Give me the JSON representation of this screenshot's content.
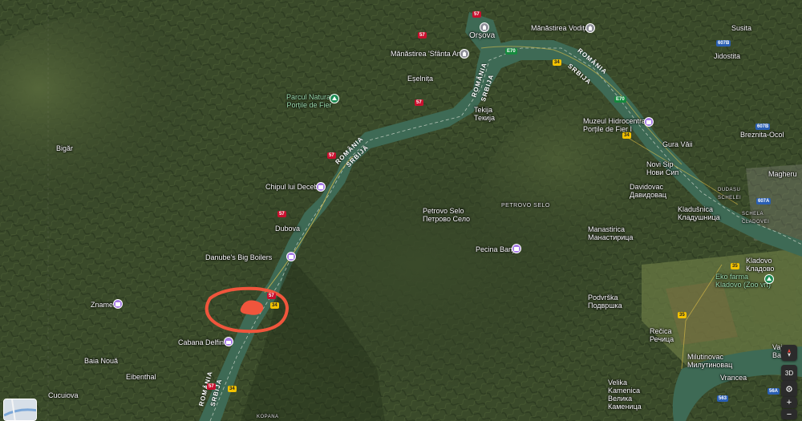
{
  "map": {
    "view": "satellite",
    "river": "Danube",
    "colors": {
      "water": "#3e6a55",
      "terrain_dark": "#2e3b24",
      "terrain_mid": "#4a5a33",
      "annotation": "#f0553c",
      "poi_purple": "#a67ae6",
      "poi_green": "#1f8c55",
      "road_yellow": "#f2c200"
    },
    "annotation": {
      "type": "hand-drawn circle with filled blob",
      "color": "#f0553c"
    }
  },
  "places": {
    "orsova": "Orșova",
    "manastirea_vodita": "Mănăstirea Vodița",
    "susita": "Susita",
    "manastirea_sfanta_ana": "Mănăstirea 'Sfânta Ana'",
    "jidostita": "Jidostita",
    "eselnita": "Eșelnița",
    "parcul_natural": "Parcul Natural\nPorțile de Fier",
    "tekija": "Tekija",
    "tekija_cyr": "Текија",
    "muzeul_hidro": "Muzeul Hidrocentralei\nPorțile de Fier I",
    "bigar": "Bigăr",
    "breznita": "Breznita-Ocol",
    "gura_vaii": "Gura Văii",
    "novi_sip": "Novi Sip",
    "novi_sip_cyr": "Нови Сип",
    "magheru": "Magheru",
    "chipul_decebal": "Chipul lui Decebal",
    "davidovac": "Davidovac",
    "davidovac_cyr": "Давидовац",
    "dudasu": "DUDAȘU\nSCHELEI",
    "schela": "SCHELA\nCLADOVEI",
    "petrovo_selo": "Petrovo Selo",
    "petrovo_selo_cyr": "Петрово Село",
    "petrovo_selo_road": "PETROVO SELO",
    "kladusnica": "Kladušnica",
    "kladusnica_cyr": "Кладушница",
    "dubova": "Dubova",
    "manastirica": "Manastirica",
    "manastirica_cyr": "Манастирица",
    "pecina_banja": "Pecina Banja",
    "danube_boilers": "Danube's Big Boilers",
    "kladovo": "Kladovo",
    "kladovo_cyr": "Кладово",
    "eko_farma": "Eko farma\nKladovo (Zoo vrt)",
    "znameni": "Znameni",
    "podvrska": "Podvrška",
    "podvrska_cyr": "Подвршка",
    "cabana_delfinul": "Cabana Delfinul",
    "baia_noua": "Baia Nouă",
    "recica": "Rečica",
    "recica_cyr": "Речица",
    "milutinovac": "Milutinovac",
    "milutinovac_cyr": "Милутиновац",
    "eibenthal": "Eibenthal",
    "vrancea": "Vrancea",
    "velika_kamenica": "Velika\nKamenica",
    "velika_kamenica_cyr": "Велика\nКаменица",
    "cucuiova": "Cucuiova",
    "kopana": "KOPANA",
    "vajuga": "Vaj\nBa"
  },
  "border_labels": {
    "romania": "ROMÂNIA",
    "srbija": "SRBIJA"
  },
  "road_shields": {
    "dn57": "57",
    "e70": "E70",
    "r34": "34",
    "r35": "35",
    "r607b": "607B",
    "r607a": "607A",
    "r563": "563",
    "r56a": "56A"
  },
  "controls": {
    "compass": "compass-icon",
    "view_3d": "3D",
    "locate": "locate-icon",
    "zoom_in": "+",
    "zoom_out": "−"
  }
}
